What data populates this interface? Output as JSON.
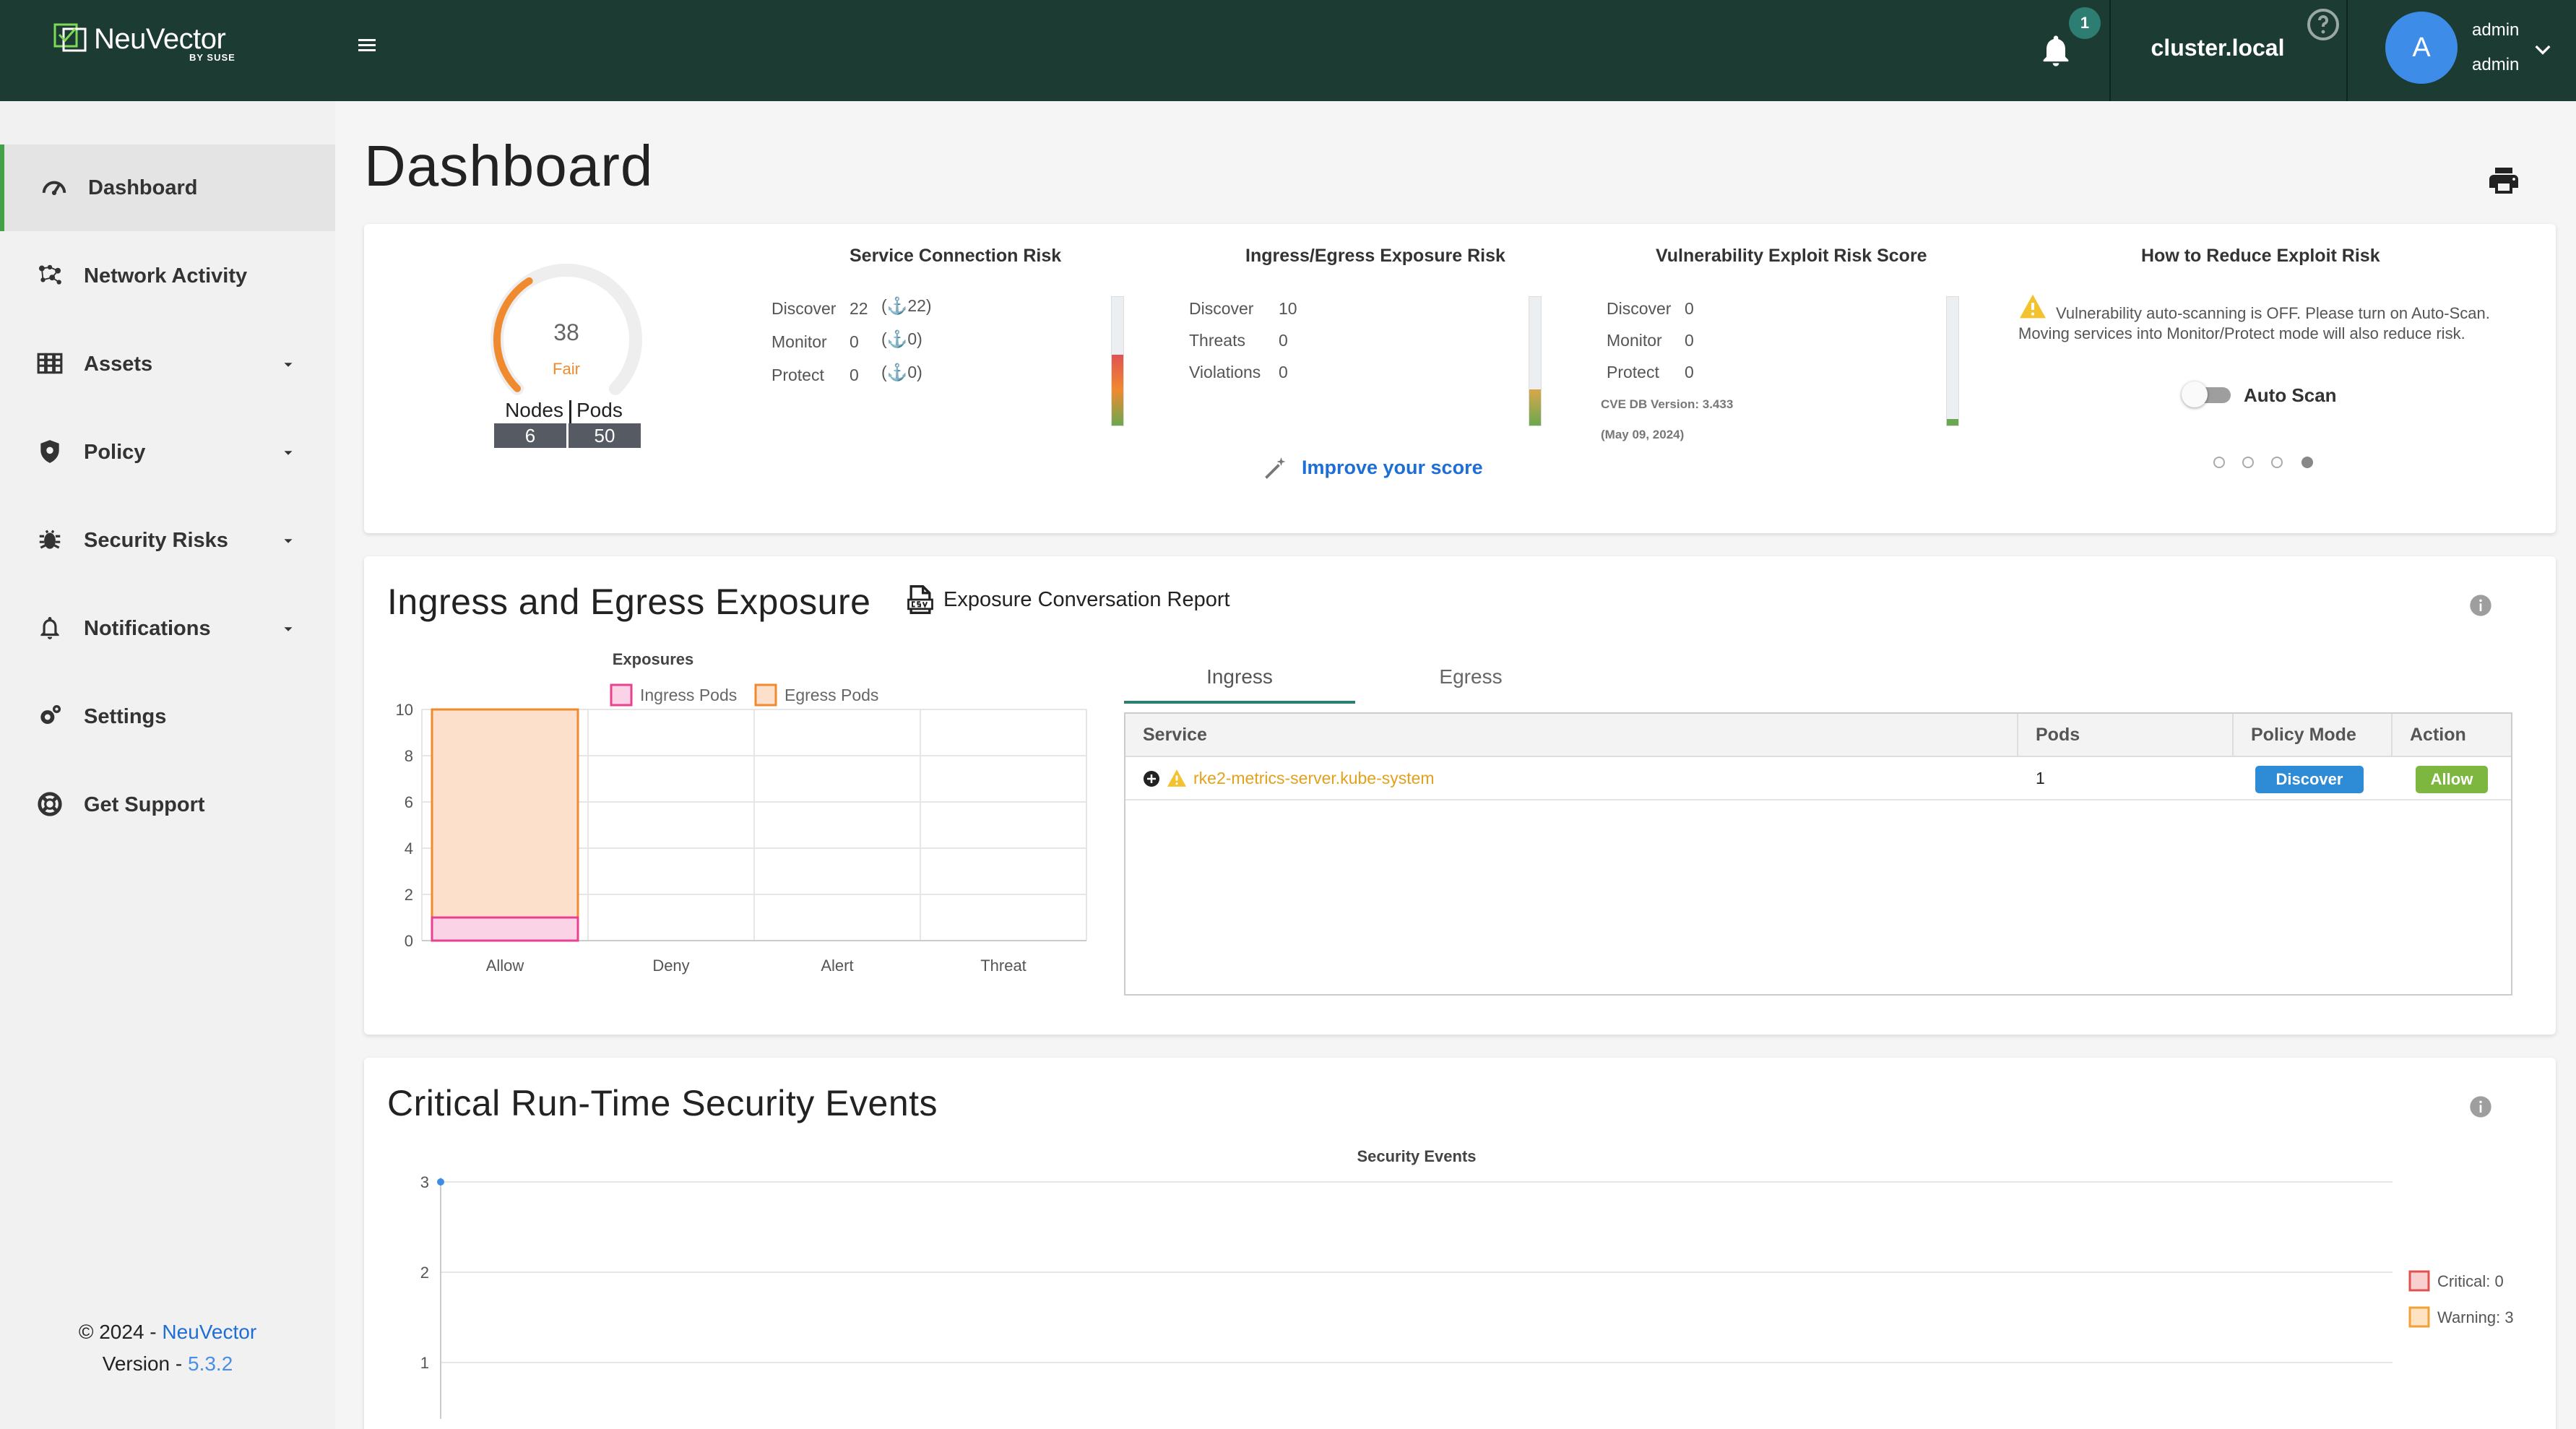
{
  "header": {
    "logo_text": "NeuVector",
    "logo_sub": "BY SUSE",
    "notifications_count": "1",
    "cluster": "cluster.local",
    "avatar_letter": "A",
    "user_name": "admin",
    "user_role": "admin"
  },
  "sidebar": {
    "items": [
      {
        "label": "Dashboard",
        "icon": "gauge-icon",
        "active": true
      },
      {
        "label": "Network Activity",
        "icon": "network-icon"
      },
      {
        "label": "Assets",
        "icon": "assets-icon",
        "has_caret": true
      },
      {
        "label": "Policy",
        "icon": "shield-icon",
        "has_caret": true
      },
      {
        "label": "Security Risks",
        "icon": "bug-icon",
        "has_caret": true
      },
      {
        "label": "Notifications",
        "icon": "bell-icon",
        "has_caret": true
      },
      {
        "label": "Settings",
        "icon": "gear-icon"
      },
      {
        "label": "Get Support",
        "icon": "lifebuoy-icon"
      }
    ],
    "footer_copy_prefix": "© 2024 - ",
    "footer_copy_link": "NeuVector",
    "footer_version_prefix": "Version - ",
    "footer_version": "5.3.2"
  },
  "page_title": "Dashboard",
  "score": {
    "gauge_value": "38",
    "gauge_label": "Fair",
    "gauge_fraction": 0.38,
    "nodes_label": "Nodes",
    "pods_label": "Pods",
    "nodes": "6",
    "pods": "50",
    "service_connection": {
      "title": "Service Connection Risk",
      "rows": [
        {
          "label": "Discover",
          "value": "22",
          "anchor": "22"
        },
        {
          "label": "Monitor",
          "value": "0",
          "anchor": "0"
        },
        {
          "label": "Protect",
          "value": "0",
          "anchor": "0"
        }
      ],
      "bar_fill": 0.55
    },
    "ingress_egress": {
      "title": "Ingress/Egress Exposure Risk",
      "rows": [
        {
          "label": "Discover",
          "value": "10"
        },
        {
          "label": "Threats",
          "value": "0"
        },
        {
          "label": "Violations",
          "value": "0"
        }
      ],
      "bar_fill": 0.28
    },
    "vulnerability": {
      "title": "Vulnerability Exploit Risk Score",
      "rows": [
        {
          "label": "Discover",
          "value": "0"
        },
        {
          "label": "Monitor",
          "value": "0"
        },
        {
          "label": "Protect",
          "value": "0"
        }
      ],
      "cve_version": "CVE DB Version: 3.433",
      "cve_date": "(May 09, 2024)",
      "bar_fill": 0.05
    },
    "reduce": {
      "title": "How to Reduce Exploit Risk",
      "text": "Vulnerability auto-scanning is OFF. Please turn on Auto-Scan. Moving services into Monitor/Protect mode will also reduce risk.",
      "toggle_label": "Auto Scan",
      "toggle_on": false
    },
    "improve_link": "Improve your score"
  },
  "exposure": {
    "title": "Ingress and Egress Exposure",
    "report_link": "Exposure Conversation Report",
    "tabs": [
      "Ingress",
      "Egress"
    ],
    "table": {
      "headers": [
        "Service",
        "Pods",
        "Policy Mode",
        "Action"
      ],
      "rows": [
        {
          "service": "rke2-metrics-server.kube-system",
          "pods": "1",
          "policy_mode": "Discover",
          "action": "Allow"
        }
      ]
    }
  },
  "events": {
    "title": "Critical Run-Time Security Events"
  },
  "colors": {
    "header_bg": "#1c3b32",
    "accent_green": "#43a047",
    "ingress": "#e8418f",
    "egress": "#f08a2f",
    "critical": "#e05252",
    "warning": "#f0a13a"
  },
  "chart_data": [
    {
      "type": "bar",
      "title": "Exposures",
      "categories": [
        "Allow",
        "Deny",
        "Alert",
        "Threat"
      ],
      "series": [
        {
          "name": "Ingress Pods",
          "values": [
            1,
            0,
            0,
            0
          ]
        },
        {
          "name": "Egress Pods",
          "values": [
            10,
            0,
            0,
            0
          ]
        }
      ],
      "ylim": [
        0,
        10
      ],
      "yticks": [
        0,
        2,
        4,
        6,
        8,
        10
      ],
      "grid": true,
      "legend": "top"
    },
    {
      "type": "line",
      "title": "Security Events",
      "series": [
        {
          "name": "Critical: 0",
          "values": []
        },
        {
          "name": "Warning: 3",
          "values": [
            3
          ]
        }
      ],
      "ylim": [
        1,
        3
      ],
      "yticks": [
        1,
        2,
        3
      ],
      "grid": true,
      "legend": "right"
    }
  ]
}
